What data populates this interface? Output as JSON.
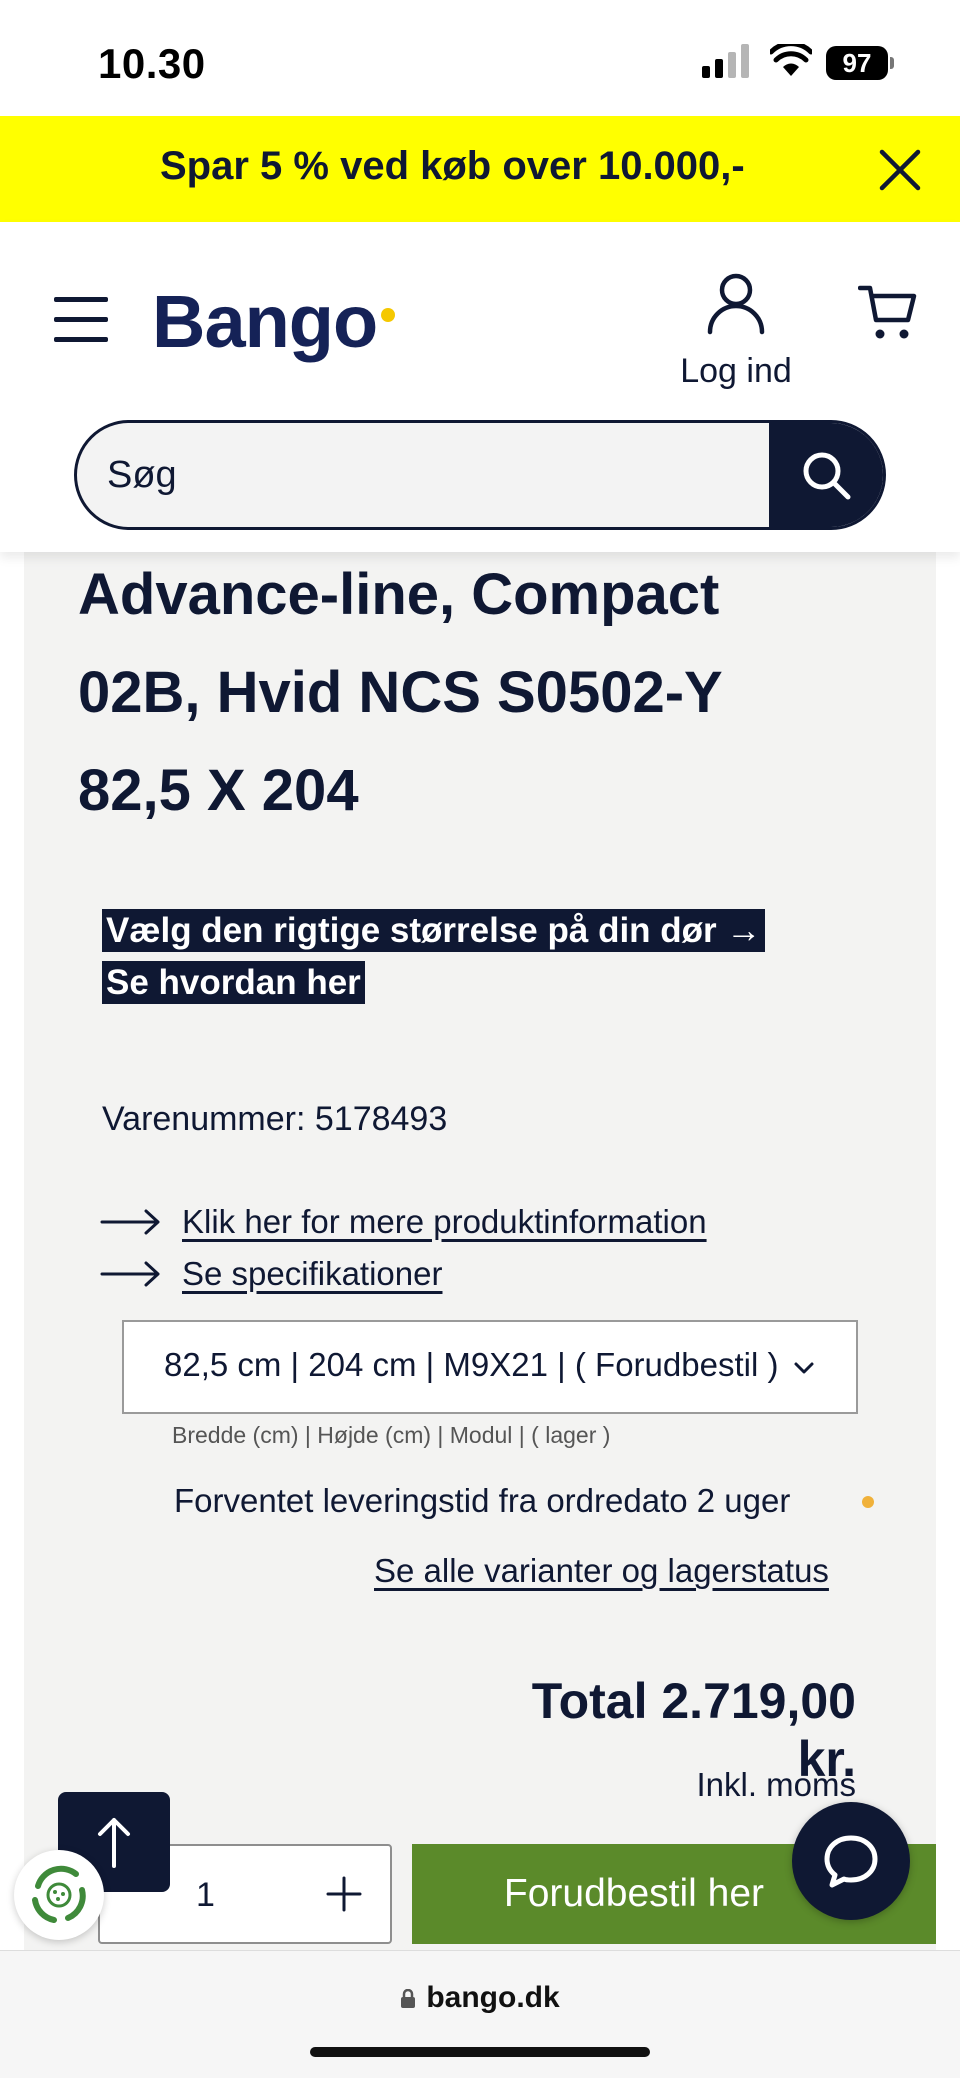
{
  "status_bar": {
    "time": "10.30",
    "battery": "97"
  },
  "promo": {
    "text": "Spar 5 % ved køb over 10.000,-"
  },
  "header": {
    "logo": "Bango",
    "login_label": "Log ind",
    "search_placeholder": "Søg"
  },
  "product": {
    "title_lines": [
      "Advance-line, Compact",
      "02B, Hvid NCS S0502-Y",
      "82,5 X 204"
    ],
    "guide_text": "Vælg den rigtige størrelse på din dør → Se hvordan her",
    "sku": "Varenummer: 5178493",
    "links": [
      "Klik her for mere produktinformation",
      "Se specifikationer"
    ],
    "variant_value": "82,5 cm | 204 cm | M9X21 | ( Forudbestil )",
    "variant_caption": "Bredde (cm) | Højde (cm) | Modul | ( lager )",
    "delivery": "Forventet leveringstid fra ordredato 2 uger",
    "variants_link": "Se alle varianter og lagerstatus",
    "total": "Total 2.719,00 kr.",
    "vat_note": "Inkl. moms",
    "quantity": "1",
    "cta_label": "Forudbestil her"
  },
  "browser": {
    "url": "bango.dk"
  },
  "colors": {
    "navy": "#0f1833",
    "brand_blue": "#152257",
    "promo_yellow": "#ffff00",
    "cta_green": "#5b8a2a",
    "delivery_dot": "#f0b13a"
  }
}
